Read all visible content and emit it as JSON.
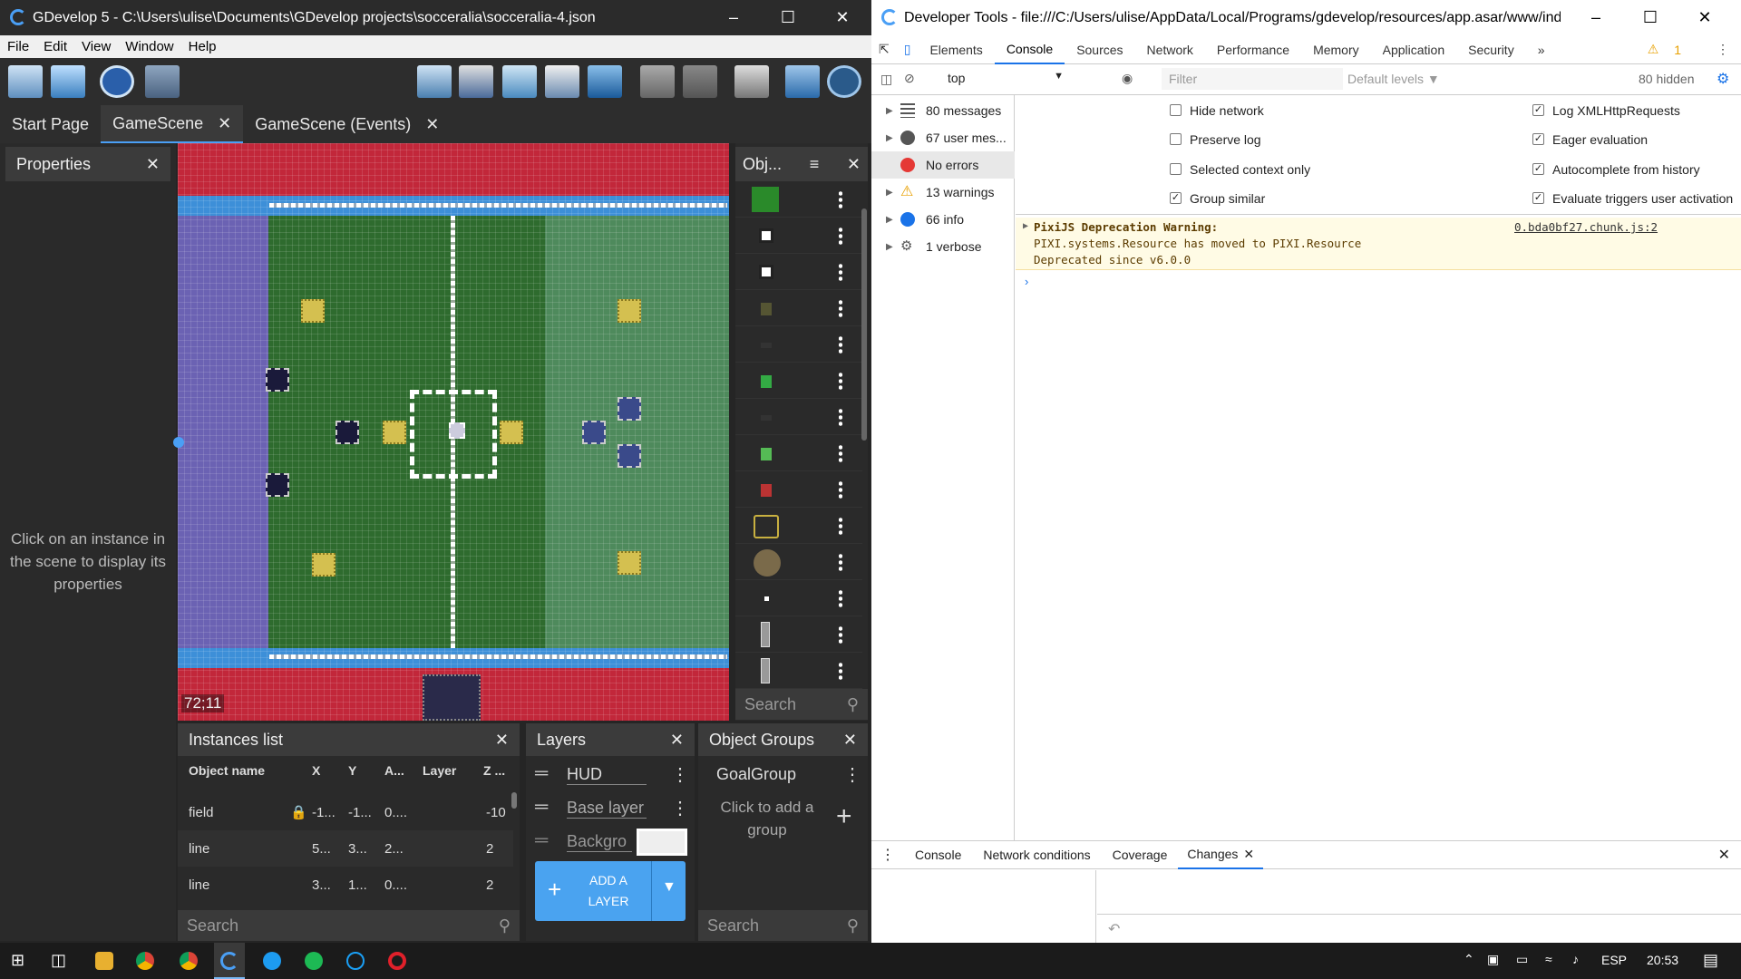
{
  "gdevelop": {
    "title": "GDevelop 5 - C:\\Users\\ulise\\Documents\\GDevelop projects\\socceralia\\socceralia-4.json",
    "menu": [
      "File",
      "Edit",
      "View",
      "Window",
      "Help"
    ],
    "tabs": [
      {
        "label": "Start Page"
      },
      {
        "label": "GameScene"
      },
      {
        "label": "GameScene (Events)"
      }
    ],
    "properties": {
      "title": "Properties",
      "hint": "Click on an instance in the scene to display its properties"
    },
    "coords": "72;11",
    "objects": {
      "title": "Obj...",
      "search": "Search"
    },
    "instances": {
      "title": "Instances list",
      "columns": [
        "Object name",
        "X",
        "Y",
        "A...",
        "Layer",
        "Z ..."
      ],
      "rows": [
        {
          "name": "field",
          "x": "-1...",
          "y": "-1...",
          "a": "0....",
          "layer": "",
          "z": "-10"
        },
        {
          "name": "line",
          "x": "5...",
          "y": "3...",
          "a": "2...",
          "layer": "",
          "z": "2"
        },
        {
          "name": "line",
          "x": "3...",
          "y": "1...",
          "a": "0....",
          "layer": "",
          "z": "2"
        }
      ],
      "search": "Search"
    },
    "layers": {
      "title": "Layers",
      "items": [
        "HUD",
        "Base layer",
        "Backgro"
      ],
      "add": "ADD A LAYER"
    },
    "groups": {
      "title": "Object Groups",
      "items": [
        "GoalGroup"
      ],
      "hint": "Click to add a group",
      "search": "Search"
    }
  },
  "devtools": {
    "title": "Developer Tools - file:///C:/Users/ulise/AppData/Local/Programs/gdevelop/resources/app.asar/www/index.html",
    "tabs": [
      "Elements",
      "Console",
      "Sources",
      "Network",
      "Performance",
      "Memory",
      "Application",
      "Security"
    ],
    "warn_count": "1",
    "context": "top",
    "filter_placeholder": "Filter",
    "levels": "Default levels",
    "hidden": "80 hidden",
    "sidebar": [
      "80 messages",
      "67 user mes...",
      "No errors",
      "13 warnings",
      "66 info",
      "1 verbose"
    ],
    "options_left": [
      "Hide network",
      "Preserve log",
      "Selected context only",
      "Group similar"
    ],
    "options_right": [
      "Log XMLHttpRequests",
      "Eager evaluation",
      "Autocomplete from history",
      "Evaluate triggers user activation"
    ],
    "message": {
      "head": "PixiJS Deprecation Warning:",
      "line1": "PIXI.systems.Resource has moved to PIXI.Resource",
      "line2": "Deprecated since v6.0.0",
      "source": "0.bda0bf27.chunk.js:2"
    },
    "drawer_tabs": [
      "Console",
      "Network conditions",
      "Coverage",
      "Changes"
    ]
  },
  "taskbar": {
    "lang": "ESP",
    "time": "20:53"
  }
}
